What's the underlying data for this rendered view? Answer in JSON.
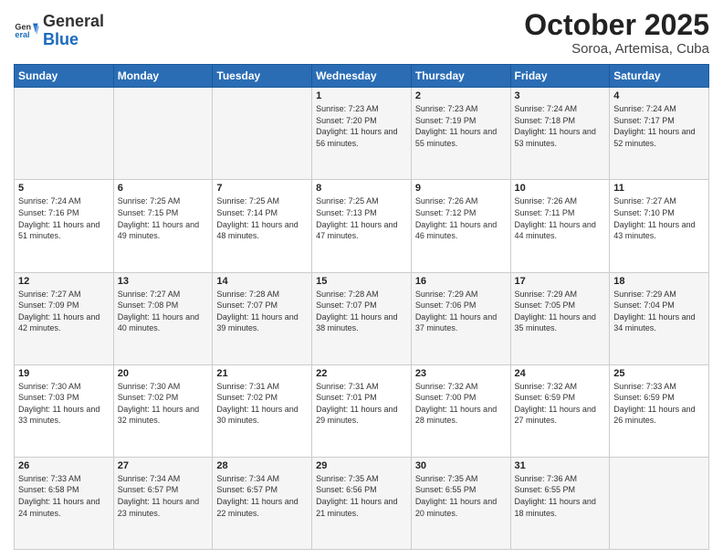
{
  "header": {
    "logo": {
      "general": "General",
      "blue": "Blue"
    },
    "title": "October 2025",
    "location": "Soroa, Artemisa, Cuba"
  },
  "weekdays": [
    "Sunday",
    "Monday",
    "Tuesday",
    "Wednesday",
    "Thursday",
    "Friday",
    "Saturday"
  ],
  "weeks": [
    [
      {
        "day": "",
        "sunrise": "",
        "sunset": "",
        "daylight": ""
      },
      {
        "day": "",
        "sunrise": "",
        "sunset": "",
        "daylight": ""
      },
      {
        "day": "",
        "sunrise": "",
        "sunset": "",
        "daylight": ""
      },
      {
        "day": "1",
        "sunrise": "7:23 AM",
        "sunset": "7:20 PM",
        "daylight": "11 hours and 56 minutes."
      },
      {
        "day": "2",
        "sunrise": "7:23 AM",
        "sunset": "7:19 PM",
        "daylight": "11 hours and 55 minutes."
      },
      {
        "day": "3",
        "sunrise": "7:24 AM",
        "sunset": "7:18 PM",
        "daylight": "11 hours and 53 minutes."
      },
      {
        "day": "4",
        "sunrise": "7:24 AM",
        "sunset": "7:17 PM",
        "daylight": "11 hours and 52 minutes."
      }
    ],
    [
      {
        "day": "5",
        "sunrise": "7:24 AM",
        "sunset": "7:16 PM",
        "daylight": "11 hours and 51 minutes."
      },
      {
        "day": "6",
        "sunrise": "7:25 AM",
        "sunset": "7:15 PM",
        "daylight": "11 hours and 49 minutes."
      },
      {
        "day": "7",
        "sunrise": "7:25 AM",
        "sunset": "7:14 PM",
        "daylight": "11 hours and 48 minutes."
      },
      {
        "day": "8",
        "sunrise": "7:25 AM",
        "sunset": "7:13 PM",
        "daylight": "11 hours and 47 minutes."
      },
      {
        "day": "9",
        "sunrise": "7:26 AM",
        "sunset": "7:12 PM",
        "daylight": "11 hours and 46 minutes."
      },
      {
        "day": "10",
        "sunrise": "7:26 AM",
        "sunset": "7:11 PM",
        "daylight": "11 hours and 44 minutes."
      },
      {
        "day": "11",
        "sunrise": "7:27 AM",
        "sunset": "7:10 PM",
        "daylight": "11 hours and 43 minutes."
      }
    ],
    [
      {
        "day": "12",
        "sunrise": "7:27 AM",
        "sunset": "7:09 PM",
        "daylight": "11 hours and 42 minutes."
      },
      {
        "day": "13",
        "sunrise": "7:27 AM",
        "sunset": "7:08 PM",
        "daylight": "11 hours and 40 minutes."
      },
      {
        "day": "14",
        "sunrise": "7:28 AM",
        "sunset": "7:07 PM",
        "daylight": "11 hours and 39 minutes."
      },
      {
        "day": "15",
        "sunrise": "7:28 AM",
        "sunset": "7:07 PM",
        "daylight": "11 hours and 38 minutes."
      },
      {
        "day": "16",
        "sunrise": "7:29 AM",
        "sunset": "7:06 PM",
        "daylight": "11 hours and 37 minutes."
      },
      {
        "day": "17",
        "sunrise": "7:29 AM",
        "sunset": "7:05 PM",
        "daylight": "11 hours and 35 minutes."
      },
      {
        "day": "18",
        "sunrise": "7:29 AM",
        "sunset": "7:04 PM",
        "daylight": "11 hours and 34 minutes."
      }
    ],
    [
      {
        "day": "19",
        "sunrise": "7:30 AM",
        "sunset": "7:03 PM",
        "daylight": "11 hours and 33 minutes."
      },
      {
        "day": "20",
        "sunrise": "7:30 AM",
        "sunset": "7:02 PM",
        "daylight": "11 hours and 32 minutes."
      },
      {
        "day": "21",
        "sunrise": "7:31 AM",
        "sunset": "7:02 PM",
        "daylight": "11 hours and 30 minutes."
      },
      {
        "day": "22",
        "sunrise": "7:31 AM",
        "sunset": "7:01 PM",
        "daylight": "11 hours and 29 minutes."
      },
      {
        "day": "23",
        "sunrise": "7:32 AM",
        "sunset": "7:00 PM",
        "daylight": "11 hours and 28 minutes."
      },
      {
        "day": "24",
        "sunrise": "7:32 AM",
        "sunset": "6:59 PM",
        "daylight": "11 hours and 27 minutes."
      },
      {
        "day": "25",
        "sunrise": "7:33 AM",
        "sunset": "6:59 PM",
        "daylight": "11 hours and 26 minutes."
      }
    ],
    [
      {
        "day": "26",
        "sunrise": "7:33 AM",
        "sunset": "6:58 PM",
        "daylight": "11 hours and 24 minutes."
      },
      {
        "day": "27",
        "sunrise": "7:34 AM",
        "sunset": "6:57 PM",
        "daylight": "11 hours and 23 minutes."
      },
      {
        "day": "28",
        "sunrise": "7:34 AM",
        "sunset": "6:57 PM",
        "daylight": "11 hours and 22 minutes."
      },
      {
        "day": "29",
        "sunrise": "7:35 AM",
        "sunset": "6:56 PM",
        "daylight": "11 hours and 21 minutes."
      },
      {
        "day": "30",
        "sunrise": "7:35 AM",
        "sunset": "6:55 PM",
        "daylight": "11 hours and 20 minutes."
      },
      {
        "day": "31",
        "sunrise": "7:36 AM",
        "sunset": "6:55 PM",
        "daylight": "11 hours and 18 minutes."
      },
      {
        "day": "",
        "sunrise": "",
        "sunset": "",
        "daylight": ""
      }
    ]
  ],
  "labels": {
    "sunrise": "Sunrise:",
    "sunset": "Sunset:",
    "daylight": "Daylight:"
  }
}
